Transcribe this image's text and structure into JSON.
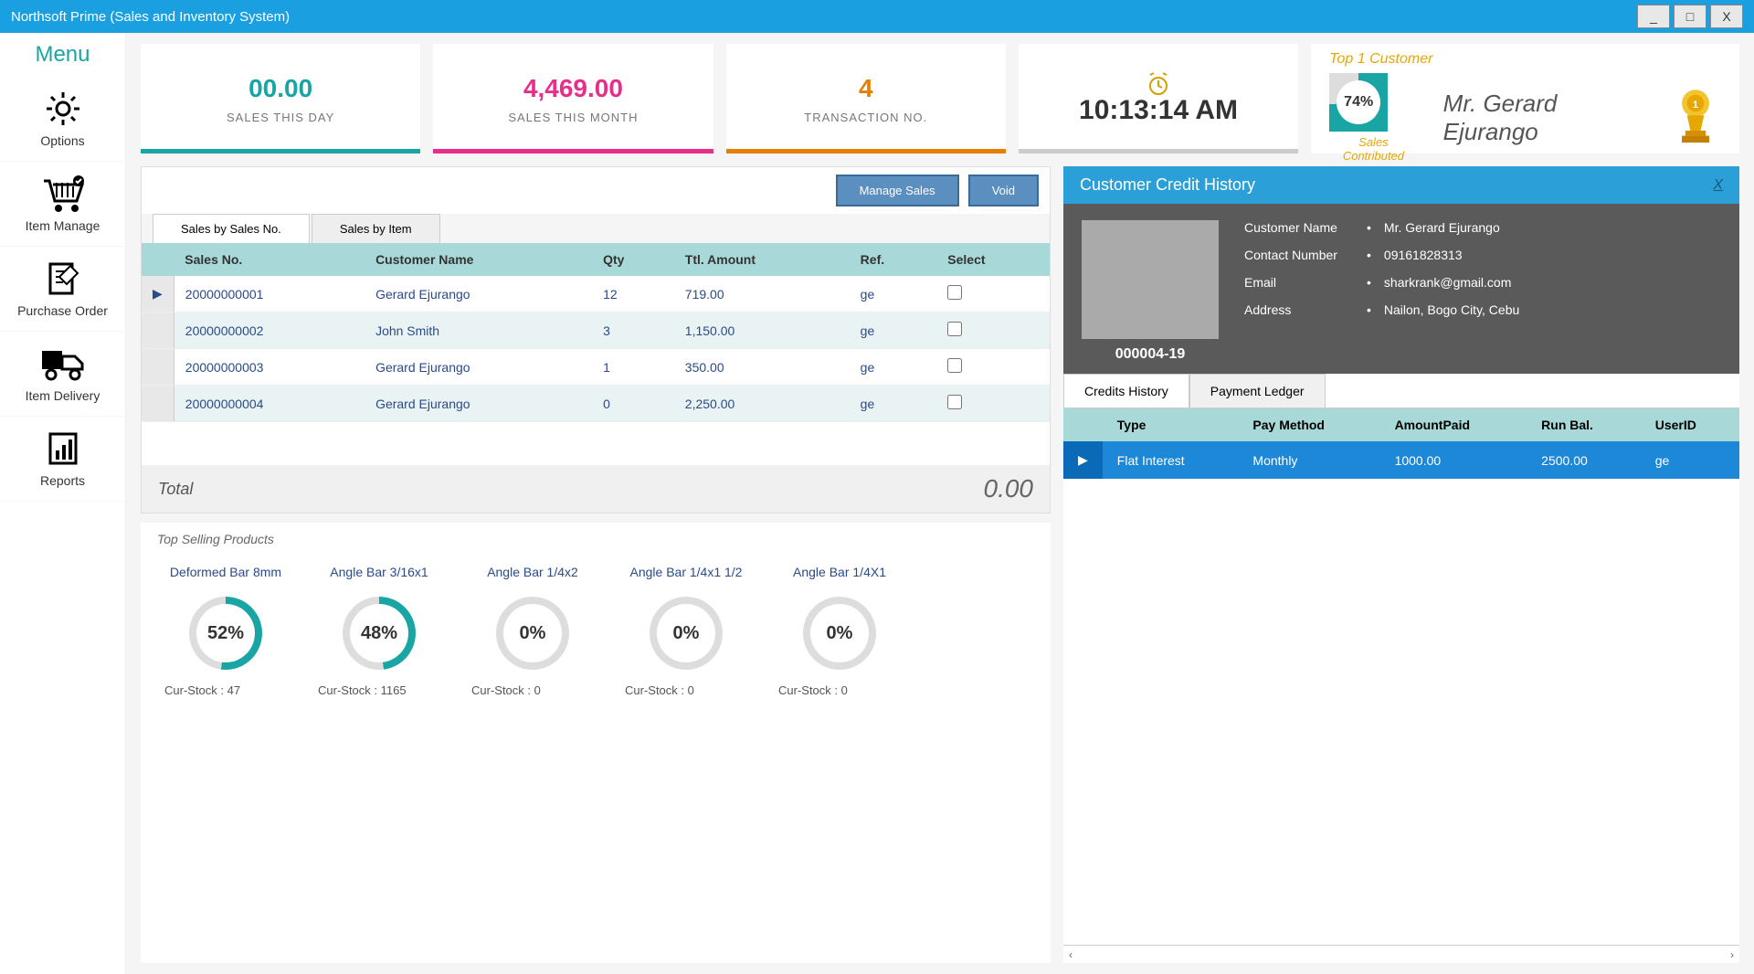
{
  "window": {
    "title": "Northsoft Prime (Sales and Inventory System)",
    "min": "_",
    "max": "□",
    "close": "X"
  },
  "sidebar": {
    "title": "Menu",
    "items": [
      {
        "label": "Options",
        "icon": "gear"
      },
      {
        "label": "Item Manage",
        "icon": "cart"
      },
      {
        "label": "Purchase Order",
        "icon": "doc"
      },
      {
        "label": "Item Delivery",
        "icon": "truck"
      },
      {
        "label": "Reports",
        "icon": "report"
      }
    ]
  },
  "stats": {
    "sales_day": {
      "value": "00.00",
      "label": "SALES THIS DAY",
      "color": "#1aa5a5"
    },
    "sales_month": {
      "value": "4,469.00",
      "label": "SALES THIS MONTH",
      "color": "#e62e8a"
    },
    "trans_no": {
      "value": "4",
      "label": "TRANSACTION NO.",
      "color": "#e67e00"
    },
    "time": "10:13:14 AM",
    "top_customer": {
      "title": "Top 1 Customer",
      "percent": 74,
      "name": "Mr. Gerard Ejurango",
      "sub": "Sales Contributed"
    }
  },
  "sales": {
    "btn_manage": "Manage Sales",
    "btn_void": "Void",
    "tabs": [
      "Sales by Sales No.",
      "Sales by Item"
    ],
    "columns": [
      "Sales No.",
      "Customer Name",
      "Qty",
      "Ttl. Amount",
      "Ref.",
      "Select"
    ],
    "rows": [
      {
        "no": "20000000001",
        "customer": "Gerard Ejurango",
        "qty": "12",
        "amount": "719.00",
        "ref": "ge"
      },
      {
        "no": "20000000002",
        "customer": "John Smith",
        "qty": "3",
        "amount": "1,150.00",
        "ref": "ge"
      },
      {
        "no": "20000000003",
        "customer": "Gerard Ejurango",
        "qty": "1",
        "amount": "350.00",
        "ref": "ge"
      },
      {
        "no": "20000000004",
        "customer": "Gerard Ejurango",
        "qty": "0",
        "amount": "2,250.00",
        "ref": "ge"
      }
    ],
    "total_label": "Total",
    "total_value": "0.00"
  },
  "top_products": {
    "title": "Top Selling Products",
    "items": [
      {
        "name": "Deformed Bar 8mm",
        "pct": 52,
        "stock": "Cur-Stock : 47"
      },
      {
        "name": "Angle Bar 3/16x1",
        "pct": 48,
        "stock": "Cur-Stock : 1165"
      },
      {
        "name": "Angle Bar 1/4x2",
        "pct": 0,
        "stock": "Cur-Stock : 0"
      },
      {
        "name": "Angle Bar 1/4x1 1/2",
        "pct": 0,
        "stock": "Cur-Stock : 0"
      },
      {
        "name": "Angle Bar 1/4X1",
        "pct": 0,
        "stock": "Cur-Stock : 0"
      }
    ]
  },
  "credit": {
    "header": "Customer Credit History",
    "close": "X",
    "customer": {
      "id": "000004-19",
      "fields": [
        {
          "label": "Customer Name",
          "value": "Mr. Gerard Ejurango"
        },
        {
          "label": "Contact Number",
          "value": "09161828313"
        },
        {
          "label": "Email",
          "value": "sharkrank@gmail.com"
        },
        {
          "label": "Address",
          "value": "Nailon, Bogo City, Cebu"
        }
      ]
    },
    "tabs": [
      "Credits History",
      "Payment Ledger"
    ],
    "columns": [
      "Type",
      "Pay Method",
      "AmountPaid",
      "Run Bal.",
      "UserID"
    ],
    "rows": [
      {
        "type": "Flat Interest",
        "method": "Monthly",
        "paid": "1000.00",
        "bal": "2500.00",
        "user": "ge"
      }
    ]
  }
}
